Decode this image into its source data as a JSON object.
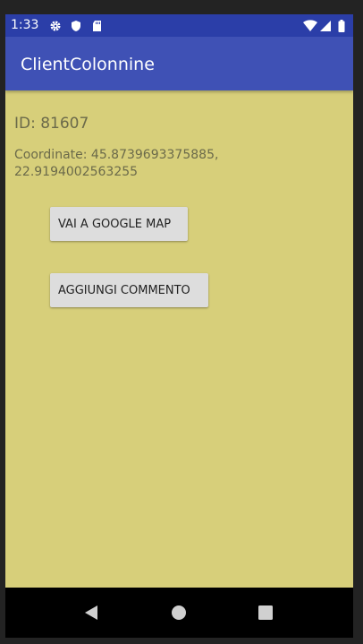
{
  "status_bar": {
    "time": "1:33",
    "icons": [
      "settings-icon",
      "shield-icon",
      "sd-card-icon",
      "wifi-icon",
      "signal-icon",
      "battery-icon"
    ]
  },
  "app_bar": {
    "title": "ClientColonnine"
  },
  "content": {
    "id_text": "ID: 81607",
    "coordinates_text": "Coordinate: 45.8739693375885, 22.9194002563255"
  },
  "buttons": {
    "map_label": "VAI A GOOGLE MAP",
    "comment_label": "AGGIUNGI COMMENTO"
  },
  "nav_bar": {
    "icons": [
      "back-icon",
      "home-icon",
      "recents-icon"
    ]
  },
  "colors": {
    "status_bar": "#2b3ea8",
    "app_bar": "#3f51b5",
    "background": "#d7cf7a",
    "button": "#dddddd",
    "nav_bar": "#000000"
  }
}
